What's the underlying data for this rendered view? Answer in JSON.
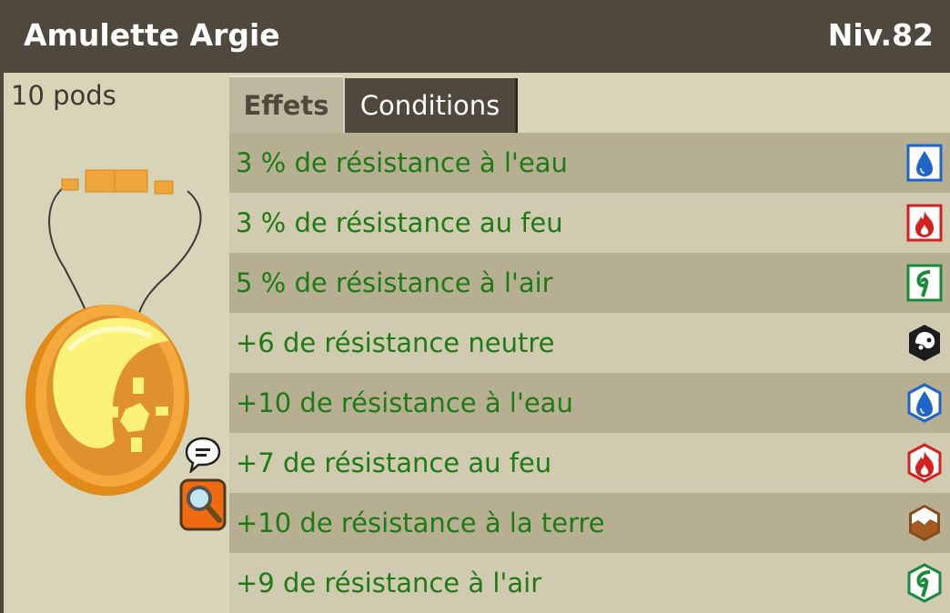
{
  "item": {
    "name": "Amulette Argie",
    "level": "Niv.82",
    "weight": "10 pods"
  },
  "tabs": [
    {
      "label": "Effets",
      "active": true
    },
    {
      "label": "Conditions",
      "active": false
    }
  ],
  "effects": [
    {
      "text": "3 % de résistance à l'eau",
      "icon": "water-square-icon"
    },
    {
      "text": "3 % de résistance au feu",
      "icon": "fire-square-icon"
    },
    {
      "text": "5 % de résistance à l'air",
      "icon": "air-square-icon"
    },
    {
      "text": "+6 de résistance neutre",
      "icon": "neutral-hex-icon"
    },
    {
      "text": "+10 de résistance à l'eau",
      "icon": "water-hex-icon"
    },
    {
      "text": "+7 de résistance au feu",
      "icon": "fire-hex-icon"
    },
    {
      "text": "+10 de résistance à la terre",
      "icon": "earth-hex-icon"
    },
    {
      "text": "+9 de résistance à l'air",
      "icon": "air-hex-icon"
    }
  ],
  "colors": {
    "header": "#4f483d",
    "effect_text": "#1f7a14",
    "row_dark": "#b6af92",
    "row_light": "#d0cbb0"
  }
}
